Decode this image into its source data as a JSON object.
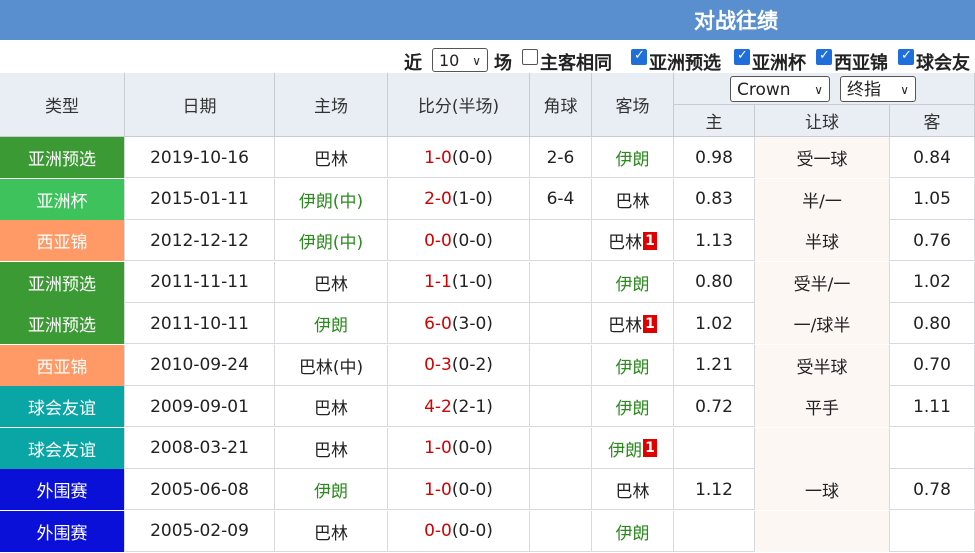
{
  "title": "对战往绩",
  "filters": {
    "near_label": "近",
    "count_value": "10",
    "games_label": "场",
    "same_home_away": {
      "label": "主客相同",
      "checked": false
    },
    "checks": [
      {
        "label": "亚洲预选",
        "checked": true
      },
      {
        "label": "亚洲杯",
        "checked": true
      },
      {
        "label": "西亚锦",
        "checked": true
      },
      {
        "label": "球会友",
        "checked": true
      }
    ]
  },
  "company_select": "Crown",
  "odds_type_select": "终指",
  "headers": {
    "type": "类型",
    "date": "日期",
    "home": "主场",
    "score": "比分(半场)",
    "corners": "角球",
    "away": "客场",
    "odds_home": "主",
    "handicap": "让球",
    "odds_away": "客"
  },
  "type_colors": {
    "亚洲预选": "#3c9a35",
    "亚洲杯": "#3ec35c",
    "西亚锦": "#ff9966",
    "球会友谊": "#0aa6a6",
    "外围赛": "#0a10d8"
  },
  "rows": [
    {
      "type": "亚洲预选",
      "date": "2019-10-16",
      "home": "巴林",
      "home_green": false,
      "home_badge": "",
      "score": "1-0",
      "half": "(0-0)",
      "corners": "2-6",
      "away": "伊朗",
      "away_green": true,
      "away_badge": "",
      "oh": "0.98",
      "hc": "受一球",
      "oa": "0.84"
    },
    {
      "type": "亚洲杯",
      "date": "2015-01-11",
      "home": "伊朗(中)",
      "home_green": true,
      "home_badge": "",
      "score": "2-0",
      "half": "(1-0)",
      "corners": "6-4",
      "away": "巴林",
      "away_green": false,
      "away_badge": "",
      "oh": "0.83",
      "hc": "半/一",
      "oa": "1.05"
    },
    {
      "type": "西亚锦",
      "date": "2012-12-12",
      "home": "伊朗(中)",
      "home_green": true,
      "home_badge": "",
      "score": "0-0",
      "half": "(0-0)",
      "corners": "",
      "away": "巴林",
      "away_green": false,
      "away_badge": "1",
      "oh": "1.13",
      "hc": "半球",
      "oa": "0.76"
    },
    {
      "type": "亚洲预选",
      "date": "2011-11-11",
      "home": "巴林",
      "home_green": false,
      "home_badge": "",
      "score": "1-1",
      "half": "(1-0)",
      "corners": "",
      "away": "伊朗",
      "away_green": true,
      "away_badge": "",
      "oh": "0.80",
      "hc": "受半/一",
      "oa": "1.02"
    },
    {
      "type": "亚洲预选",
      "date": "2011-10-11",
      "home": "伊朗",
      "home_green": true,
      "home_badge": "",
      "score": "6-0",
      "half": "(3-0)",
      "corners": "",
      "away": "巴林",
      "away_green": false,
      "away_badge": "1",
      "oh": "1.02",
      "hc": "一/球半",
      "oa": "0.80"
    },
    {
      "type": "西亚锦",
      "date": "2010-09-24",
      "home": "巴林(中)",
      "home_green": false,
      "home_badge": "",
      "score": "0-3",
      "half": "(0-2)",
      "corners": "",
      "away": "伊朗",
      "away_green": true,
      "away_badge": "",
      "oh": "1.21",
      "hc": "受半球",
      "oa": "0.70"
    },
    {
      "type": "球会友谊",
      "date": "2009-09-01",
      "home": "巴林",
      "home_green": false,
      "home_badge": "",
      "score": "4-2",
      "half": "(2-1)",
      "corners": "",
      "away": "伊朗",
      "away_green": true,
      "away_badge": "",
      "oh": "0.72",
      "hc": "平手",
      "oa": "1.11"
    },
    {
      "type": "球会友谊",
      "date": "2008-03-21",
      "home": "巴林",
      "home_green": false,
      "home_badge": "",
      "score": "1-0",
      "half": "(0-0)",
      "corners": "",
      "away": "伊朗",
      "away_green": true,
      "away_badge": "1",
      "oh": "",
      "hc": "",
      "oa": ""
    },
    {
      "type": "外围赛",
      "date": "2005-06-08",
      "home": "伊朗",
      "home_green": true,
      "home_badge": "",
      "score": "1-0",
      "half": "(0-0)",
      "corners": "",
      "away": "巴林",
      "away_green": false,
      "away_badge": "",
      "oh": "1.12",
      "hc": "一球",
      "oa": "0.78"
    },
    {
      "type": "外围赛",
      "date": "2005-02-09",
      "home": "巴林",
      "home_green": false,
      "home_badge": "",
      "score": "0-0",
      "half": "(0-0)",
      "corners": "",
      "away": "伊朗",
      "away_green": true,
      "away_badge": "",
      "oh": "",
      "hc": "",
      "oa": ""
    }
  ]
}
